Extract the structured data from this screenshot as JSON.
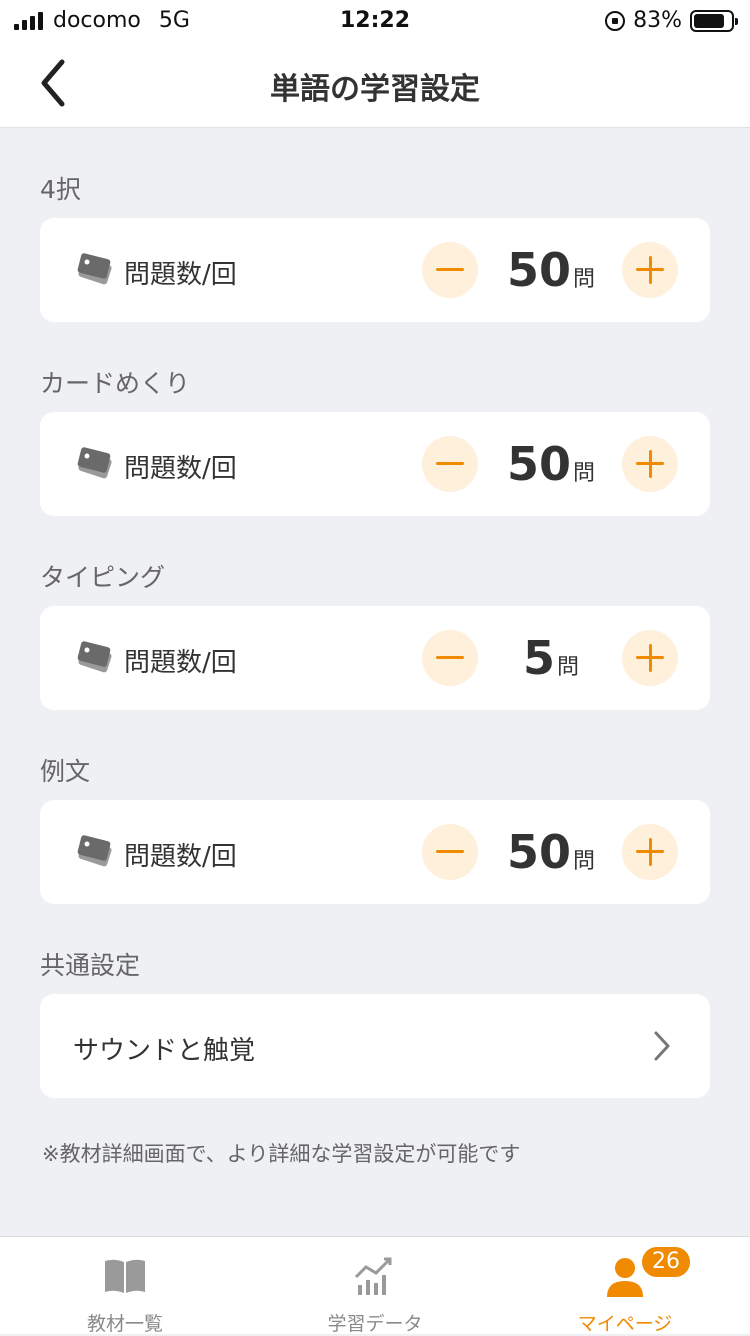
{
  "status_bar": {
    "carrier": "docomo",
    "network": "5G",
    "time": "12:22",
    "battery": "83%",
    "battery_level": 0.83
  },
  "nav": {
    "title": "単語の学習設定",
    "back_icon": "chevron-left-icon"
  },
  "sections": [
    {
      "label": "4択",
      "row_label": "問題数/回",
      "value": "50",
      "unit": "問"
    },
    {
      "label": "カードめくり",
      "row_label": "問題数/回",
      "value": "50",
      "unit": "問"
    },
    {
      "label": "タイピング",
      "row_label": "問題数/回",
      "value": "5",
      "unit": "問"
    },
    {
      "label": "例文",
      "row_label": "問題数/回",
      "value": "50",
      "unit": "問"
    }
  ],
  "common": {
    "label": "共通設定",
    "sound_label": "サウンドと触覚"
  },
  "note": "※教材詳細画面で、より詳細な学習設定が可能です",
  "tabs": [
    {
      "label": "教材一覧",
      "icon": "book-icon"
    },
    {
      "label": "学習データ",
      "icon": "chart-icon"
    },
    {
      "label": "マイページ",
      "icon": "person-icon",
      "badge": "26",
      "active": true
    }
  ],
  "colors": {
    "accent": "#f08a00",
    "accent_light": "#fff0db",
    "background": "#eff0f4"
  }
}
